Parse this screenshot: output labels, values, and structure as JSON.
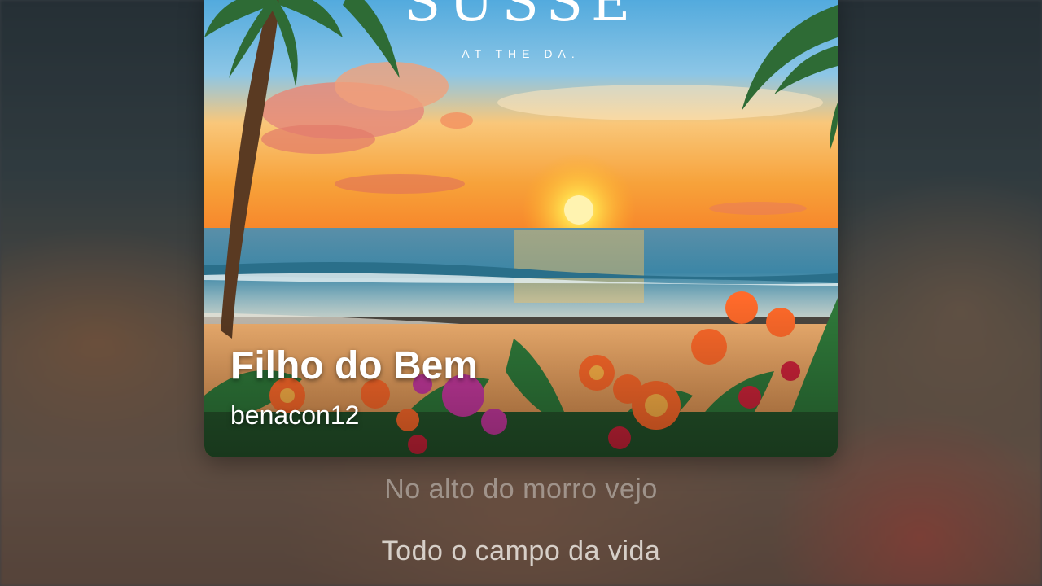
{
  "player": {
    "artwork": {
      "brand_title": "SUSSE",
      "brand_subtitle": "AT THE DA."
    },
    "song_title": "Filho do Bem",
    "artist": "benacon12"
  },
  "lyrics": [
    {
      "text": "No alto do morro vejo",
      "state": "past"
    },
    {
      "text": "Todo o campo da vida",
      "state": "upcoming"
    }
  ],
  "colors": {
    "sky_top": "#5aa9d8",
    "sunset_orange": "#f7931e",
    "sun": "#ffe066",
    "sea": "#3d8fb0",
    "sand": "#e8a15a",
    "leaf": "#2f7a3a",
    "flower": "#ff6a2a"
  }
}
